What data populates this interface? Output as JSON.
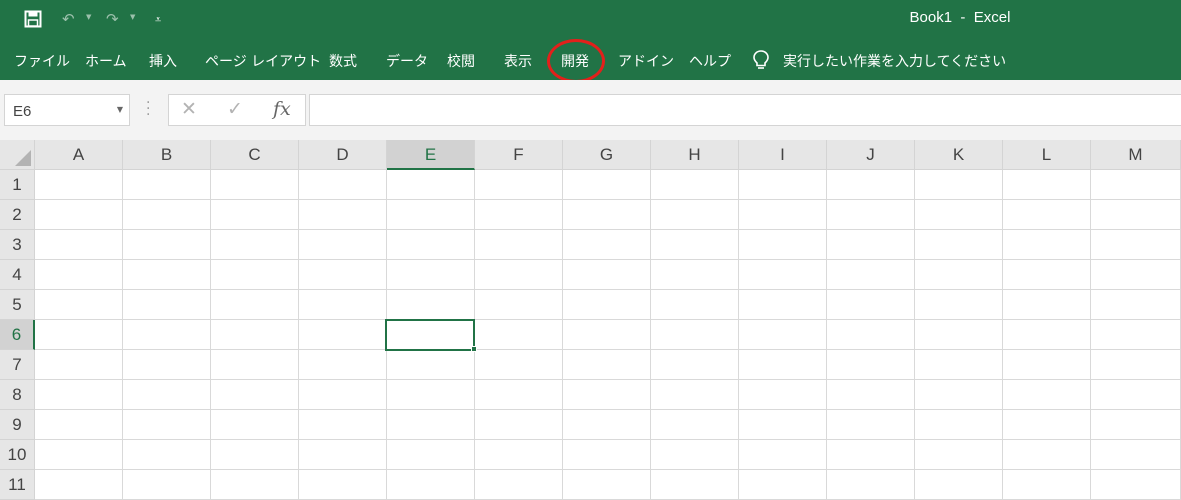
{
  "window": {
    "title": "Book1  -  Excel"
  },
  "quick_access": {
    "icons": [
      "save-icon",
      "undo-icon",
      "redo-icon",
      "customize-icon"
    ]
  },
  "ribbon": {
    "tabs": [
      {
        "label": "ファイル"
      },
      {
        "label": "ホーム"
      },
      {
        "label": "挿入"
      },
      {
        "label": "ページ レイアウト"
      },
      {
        "label": "数式"
      },
      {
        "label": "データ"
      },
      {
        "label": "校閲"
      },
      {
        "label": "表示"
      },
      {
        "label": "開発",
        "highlighted": true
      },
      {
        "label": "アドイン"
      },
      {
        "label": "ヘルプ"
      }
    ],
    "tell_me": "実行したい作業を入力してください"
  },
  "formula_bar": {
    "name_box": "E6",
    "cancel_glyph": "✕",
    "enter_glyph": "✓",
    "fx_label": "fx",
    "value": ""
  },
  "sheet": {
    "columns": [
      "A",
      "B",
      "C",
      "D",
      "E",
      "F",
      "G",
      "H",
      "I",
      "J",
      "K",
      "L",
      "M"
    ],
    "rows": [
      "1",
      "2",
      "3",
      "4",
      "5",
      "6",
      "7",
      "8",
      "9",
      "10",
      "11"
    ],
    "active_cell": "E6",
    "active_column": "E",
    "active_row": "6"
  },
  "colors": {
    "accent": "#217346",
    "highlight_ring": "#e3201b",
    "header_bg": "#e6e6e6",
    "grid_line": "#d9d9d9"
  }
}
